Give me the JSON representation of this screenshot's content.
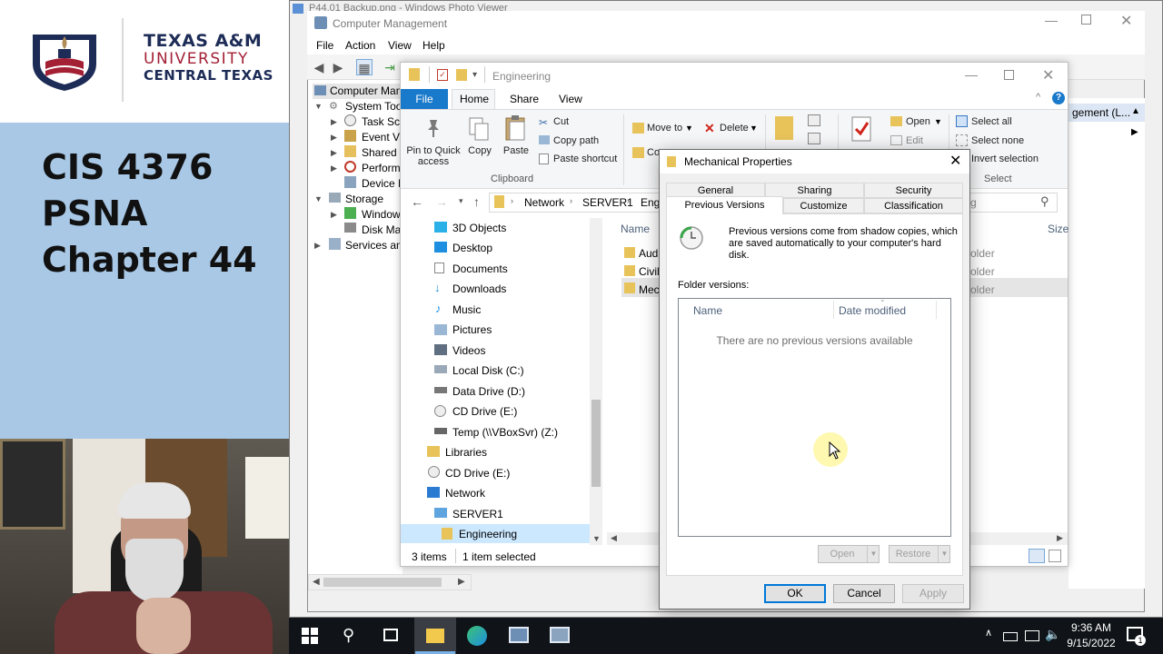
{
  "slide": {
    "logo_line1": "TEXAS A&M",
    "logo_line2": "UNIVERSITY",
    "logo_line3": "CENTRAL TEXAS",
    "title_line1": "CIS 4376",
    "title_line2": "PSNA",
    "title_line3": "Chapter 44"
  },
  "photo_viewer": {
    "title": "P44.01 Backup.png - Windows Photo Viewer"
  },
  "computer_management": {
    "title": "Computer Management",
    "menu": [
      "File",
      "Action",
      "View",
      "Help"
    ],
    "tree": [
      {
        "label": "Computer Mana",
        "level": 0
      },
      {
        "label": "System Tool",
        "level": 1
      },
      {
        "label": "Task Sch",
        "level": 2
      },
      {
        "label": "Event Vie",
        "level": 2
      },
      {
        "label": "Shared F",
        "level": 2
      },
      {
        "label": "Performa",
        "level": 2
      },
      {
        "label": "Device M",
        "level": 2
      },
      {
        "label": "Storage",
        "level": 1
      },
      {
        "label": "Window",
        "level": 2
      },
      {
        "label": "Disk Mar",
        "level": 2
      },
      {
        "label": "Services and",
        "level": 1
      }
    ],
    "actions_header": "gement (L..."
  },
  "explorer": {
    "title": "Engineering",
    "tabs": {
      "file": "File",
      "home": "Home",
      "share": "Share",
      "view": "View"
    },
    "ribbon": {
      "pin_label_1": "Pin to Quick",
      "pin_label_2": "access",
      "copy": "Copy",
      "paste": "Paste",
      "cut": "Cut",
      "copy_path": "Copy path",
      "paste_shortcut": "Paste shortcut",
      "clipboard_group": "Clipboard",
      "move_to": "Move to",
      "delete": "Delete",
      "copy_to_partial": "Co",
      "open": "Open",
      "edit": "Edit",
      "select_all": "Select all",
      "select_none": "Select none",
      "invert_selection": "Invert selection",
      "select_group": "Select"
    },
    "address": [
      "Network",
      "SERVER1",
      "Eng"
    ],
    "search_partial": "g",
    "nav_items": [
      "3D Objects",
      "Desktop",
      "Documents",
      "Downloads",
      "Music",
      "Pictures",
      "Videos",
      "Local Disk (C:)",
      "Data Drive (D:)",
      "CD Drive (E:)",
      "Temp (\\\\VBoxSvr) (Z:)",
      "Libraries",
      "CD Drive (E:)",
      "Network",
      "SERVER1",
      "Engineering"
    ],
    "columns": {
      "name": "Name",
      "size": "Size"
    },
    "files": [
      "Aud",
      "Civil",
      "Mec"
    ],
    "file_type_partial": "older",
    "status_items": "3 items",
    "status_selected": "1 item selected"
  },
  "dialog": {
    "title": "Mechanical Properties",
    "tabs_row1": [
      "General",
      "Sharing",
      "Security"
    ],
    "tabs_row2": [
      "Previous Versions",
      "Customize",
      "Classification"
    ],
    "description": "Previous versions come from shadow copies, which are saved automatically to your computer's hard disk.",
    "folder_versions_label": "Folder versions:",
    "col_name": "Name",
    "col_date": "Date modified",
    "empty_message": "There are no previous versions available",
    "open_btn": "Open",
    "restore_btn": "Restore",
    "ok": "OK",
    "cancel": "Cancel",
    "apply": "Apply"
  },
  "taskbar": {
    "time": "9:36 AM",
    "date": "9/15/2022",
    "notification_count": "1"
  },
  "colors": {
    "slide_bg": "#a8c8e6",
    "ribbon_file_tab": "#1979ca",
    "selection": "#cce8ff",
    "taskbar": "#101418"
  }
}
